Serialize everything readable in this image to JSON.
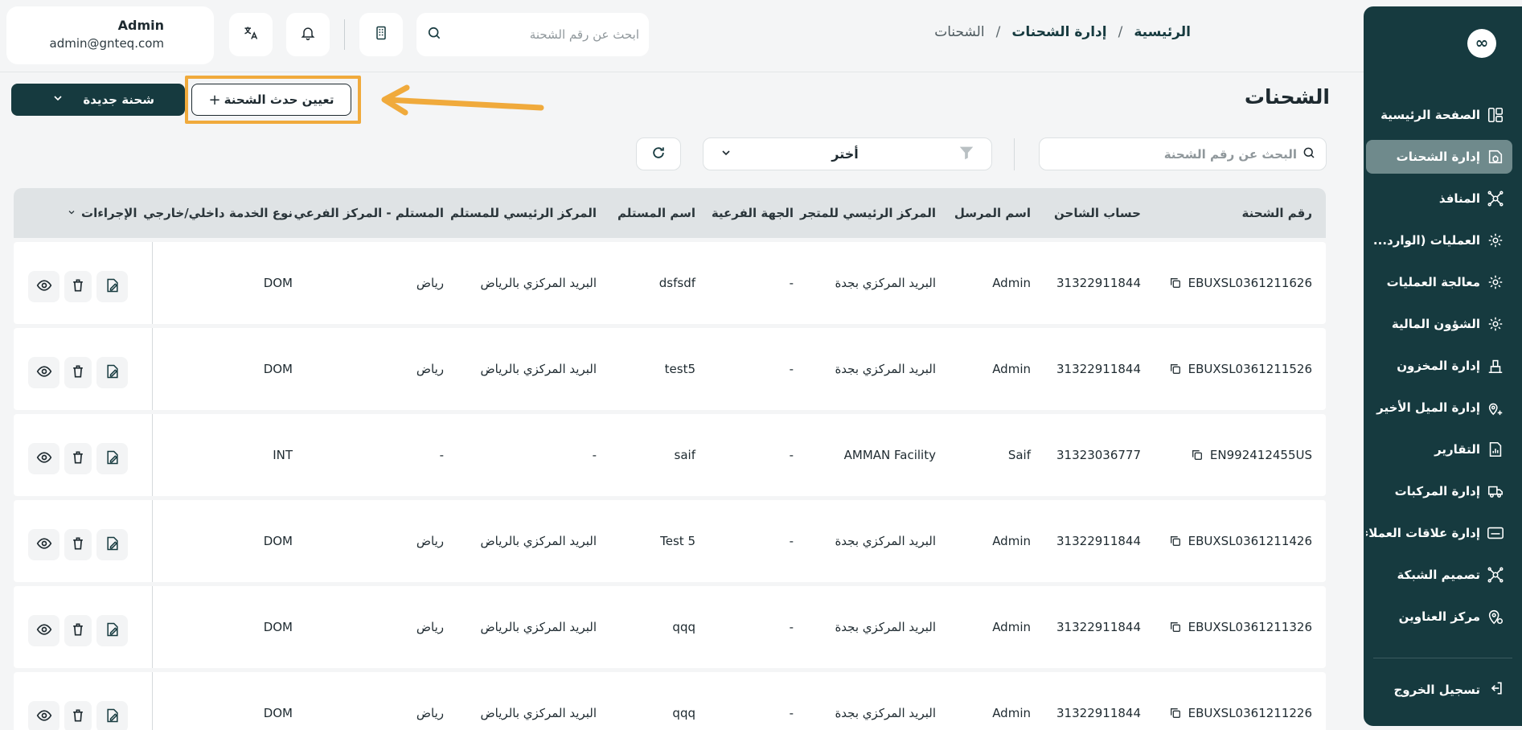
{
  "header": {
    "user_name": "Admin",
    "user_email": "admin@gnteq.com",
    "search_placeholder": "ابحث عن رقم الشحنة"
  },
  "breadcrumb": {
    "home": "الرئيسية",
    "section": "إدارة الشحنات",
    "current": "الشحنات",
    "separator": "/"
  },
  "sidebar": {
    "logo": "∞",
    "items": [
      {
        "label": "الصفحة الرئيسية",
        "icon": "dashboard-icon"
      },
      {
        "label": "إدارة الشحنات",
        "icon": "package-icon",
        "active": true
      },
      {
        "label": "المنافذ",
        "icon": "network-icon"
      },
      {
        "label": "العمليات (الوارد...",
        "icon": "gear-icon"
      },
      {
        "label": "معالجة العمليات",
        "icon": "gear-icon"
      },
      {
        "label": "الشؤون المالية",
        "icon": "gear-icon"
      },
      {
        "label": "إدارة المخزون",
        "icon": "warehouse-icon"
      },
      {
        "label": "إدارة الميل الأخير",
        "icon": "location-icon"
      },
      {
        "label": "التقارير",
        "icon": "report-icon"
      },
      {
        "label": "إدارة المركبات",
        "icon": "truck-icon"
      },
      {
        "label": "إدارة علاقات العملاء",
        "icon": "crm-icon"
      },
      {
        "label": "تصميم الشبكة",
        "icon": "network-icon"
      },
      {
        "label": "مركز العناوين",
        "icon": "address-icon"
      }
    ],
    "logout": "تسجيل الخروج"
  },
  "page": {
    "title": "الشحنات",
    "new_shipment": "شحنة جديدة",
    "assign_event": "تعيين حدث الشحنة",
    "assign_plus": "+",
    "filter_search_placeholder": "البحث عن رقم الشحنة",
    "select_label": "أختر"
  },
  "table": {
    "headers": {
      "shipment_no": "رقم الشحنة",
      "shipper_account": "حساب الشاحن",
      "sender_name": "اسم المرسل",
      "store_hub": "المركز الرئيسي للمتجر",
      "branch": "الجهة الفرعية",
      "receiver_name": "اسم المستلم",
      "receiver_hub": "المركز الرئيسي للمستلم",
      "receiver_branch": "المستلم - المركز الفرعي",
      "service_type": "نوع الخدمة داخلي/خارجي",
      "actions": "الإجراءات"
    },
    "rows": [
      {
        "shipment_no": "EBUXSL0361211626",
        "shipper_account": "31322911844",
        "sender_name": "Admin",
        "store_hub": "البريد المركزي بجدة",
        "branch": "-",
        "receiver_name": "dsfsdf",
        "receiver_hub": "البريد المركزي بالرياض",
        "receiver_branch": "رياض",
        "service_type": "DOM"
      },
      {
        "shipment_no": "EBUXSL0361211526",
        "shipper_account": "31322911844",
        "sender_name": "Admin",
        "store_hub": "البريد المركزي بجدة",
        "branch": "-",
        "receiver_name": "test5",
        "receiver_hub": "البريد المركزي بالرياض",
        "receiver_branch": "رياض",
        "service_type": "DOM"
      },
      {
        "shipment_no": "EN992412455US",
        "shipper_account": "31323036777",
        "sender_name": "Saif",
        "store_hub": "AMMAN Facility",
        "branch": "-",
        "receiver_name": "saif",
        "receiver_hub": "-",
        "receiver_branch": "-",
        "service_type": "INT"
      },
      {
        "shipment_no": "EBUXSL0361211426",
        "shipper_account": "31322911844",
        "sender_name": "Admin",
        "store_hub": "البريد المركزي بجدة",
        "branch": "-",
        "receiver_name": "Test 5",
        "receiver_hub": "البريد المركزي بالرياض",
        "receiver_branch": "رياض",
        "service_type": "DOM"
      },
      {
        "shipment_no": "EBUXSL0361211326",
        "shipper_account": "31322911844",
        "sender_name": "Admin",
        "store_hub": "البريد المركزي بجدة",
        "branch": "-",
        "receiver_name": "qqq",
        "receiver_hub": "البريد المركزي بالرياض",
        "receiver_branch": "رياض",
        "service_type": "DOM"
      },
      {
        "shipment_no": "EBUXSL0361211226",
        "shipper_account": "31322911844",
        "sender_name": "Admin",
        "store_hub": "البريد المركزي بجدة",
        "branch": "-",
        "receiver_name": "qqq",
        "receiver_hub": "البريد المركزي بالرياض",
        "receiver_branch": "رياض",
        "service_type": "DOM"
      }
    ]
  },
  "colors": {
    "brand": "#163a3f",
    "highlight": "#f0aa3c"
  }
}
